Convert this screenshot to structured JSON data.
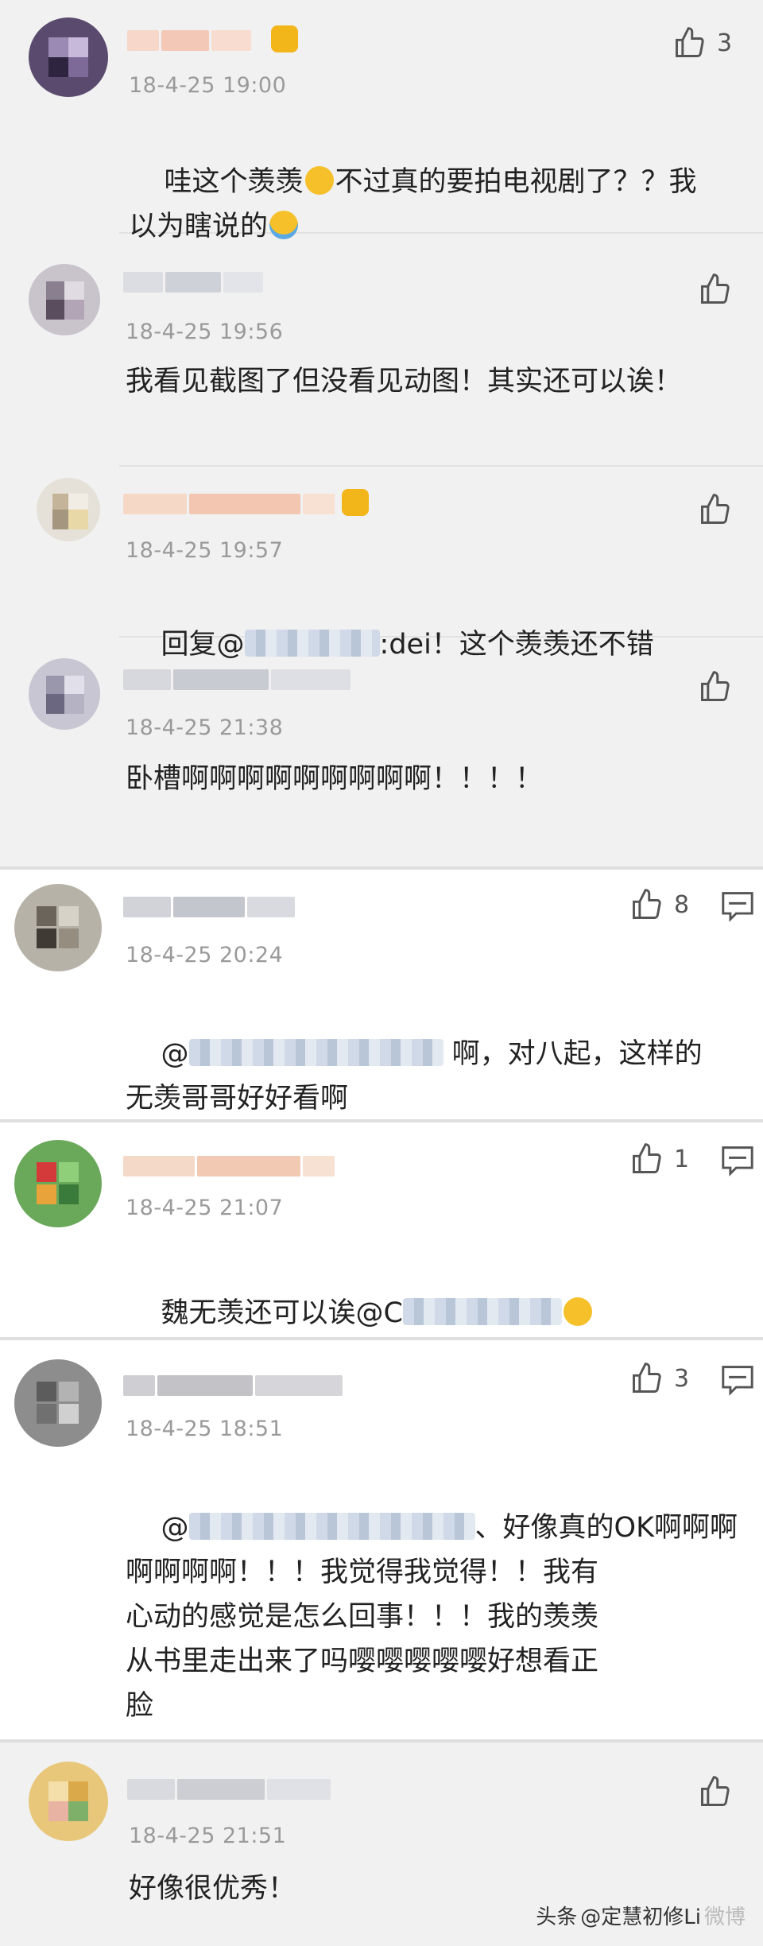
{
  "comments": [
    {
      "time": "18-4-25 19:00",
      "likes": "3",
      "text_a": "哇这个羡羡",
      "text_b": "不过真的要拍电视剧了？？我\n以为瞎说的",
      "emoji_1": "scream-emoji",
      "emoji_2": "laugh-cry-emoji"
    },
    {
      "time": "18-4-25 19:56",
      "text": "我看见截图了但没看见动图！其实还可以诶！"
    },
    {
      "time": "18-4-25 19:57",
      "text_prefix": "回复@",
      "text_suffix": ":dei！这个羡羡还不错"
    },
    {
      "time": "18-4-25 21:38",
      "text": "卧槽啊啊啊啊啊啊啊啊啊！！！！"
    },
    {
      "time": "18-4-25 20:24",
      "likes": "8",
      "text_prefix": "@",
      "text_a": " 啊，对八起，这样的",
      "text_b": "无羡哥哥好好看啊"
    },
    {
      "time": "18-4-25 21:07",
      "likes": "1",
      "text_prefix": "魏无羡还可以诶@C",
      "emoji": "smile-emoji"
    },
    {
      "time": "18-4-25 18:51",
      "likes": "3",
      "text_prefix": "@",
      "text_a": "、好像真的OK啊啊啊",
      "text_b": "啊啊啊啊！！！我觉得我觉得！！我有\n心动的感觉是怎么回事！！！我的羡羡\n从书里走出来了吗嘤嘤嘤嘤嘤好想看正\n脸"
    },
    {
      "time": "18-4-25 21:51",
      "text": "好像很优秀！"
    }
  ],
  "watermark": {
    "prefix": "头条",
    "text": "@定慧初修Li",
    "faint": "微博"
  },
  "colors": {
    "reply_bg": "#f1f1f1",
    "top_bg": "#ffffff",
    "time": "#9a9a9a",
    "text": "#222222"
  }
}
